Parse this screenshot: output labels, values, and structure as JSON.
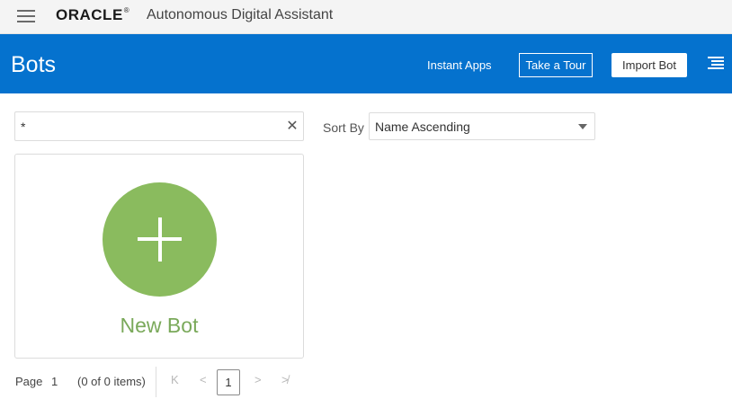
{
  "topbar": {
    "brand": "ORACLE",
    "brand_mark": "®",
    "app_title": "Autonomous Digital Assistant"
  },
  "header": {
    "title": "Bots",
    "instant_apps_label": "Instant Apps",
    "take_tour_label": "Take a Tour",
    "import_bot_label": "Import Bot"
  },
  "filter": {
    "value": "*"
  },
  "sort": {
    "label": "Sort By",
    "selected": "Name Ascending"
  },
  "new_bot_card": {
    "label": "New Bot"
  },
  "pager": {
    "page_label": "Page",
    "page_number": "1",
    "items_text": "(0 of 0 items)",
    "current_page": "1",
    "first_icon": "K",
    "prev_icon": "<",
    "next_icon": ">",
    "last_icon": "≯"
  },
  "colors": {
    "header_blue": "#0572ce",
    "new_bot_green": "#8abb5e"
  }
}
